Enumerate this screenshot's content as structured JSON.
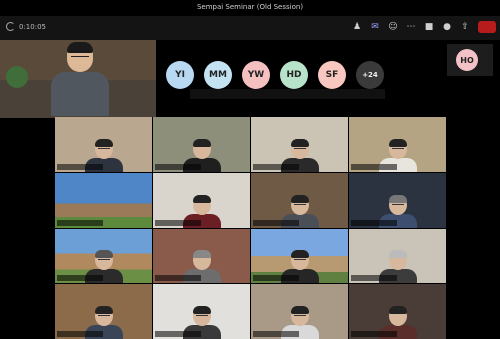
{
  "window": {
    "title": "Sempai Seminar (Old Session)"
  },
  "toolbar": {
    "timer": "0:10:05",
    "icons": [
      "people-icon",
      "chat-icon",
      "reactions-icon",
      "more-icon",
      "camera-icon",
      "mic-icon",
      "share-icon"
    ]
  },
  "avatars": [
    {
      "initials": "YI",
      "color": "#b9d8f2"
    },
    {
      "initials": "MM",
      "color": "#c4e3f2"
    },
    {
      "initials": "YW",
      "color": "#f4c0c0"
    },
    {
      "initials": "HD",
      "color": "#b6e3c9"
    },
    {
      "initials": "SF",
      "color": "#f8c8c0"
    },
    {
      "initials": "+24",
      "color": "#3a3a3a"
    }
  ],
  "right_avatar": {
    "initials": "HO",
    "color": "#f2c2c6"
  },
  "leave_color": "#b71c1c"
}
